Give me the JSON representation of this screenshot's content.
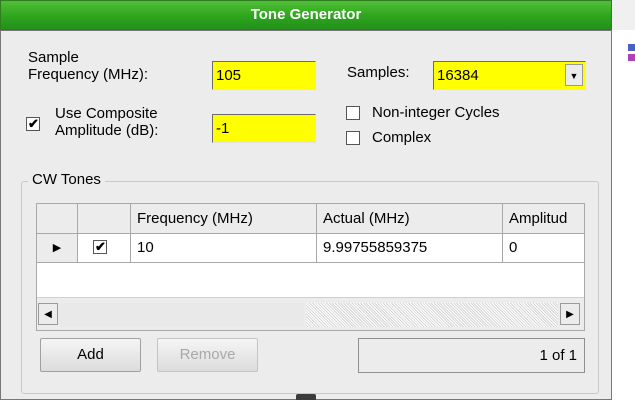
{
  "window": {
    "title": "Tone Generator"
  },
  "form": {
    "sample_frequency_label_1": "Sample",
    "sample_frequency_label_2": "Frequency (MHz):",
    "sample_frequency_value": "105",
    "samples_label": "Samples:",
    "samples_value": "16384",
    "use_composite_label_1": "Use Composite",
    "use_composite_label_2": "Amplitude (dB):",
    "use_composite_checked": true,
    "composite_amplitude_value": "-1",
    "non_integer_label": "Non-integer Cycles",
    "non_integer_checked": false,
    "complex_label": "Complex",
    "complex_checked": false
  },
  "cw_tones": {
    "title": "CW Tones",
    "columns": [
      "Frequency (MHz)",
      "Actual (MHz)",
      "Amplitud"
    ],
    "rows": [
      {
        "enabled": true,
        "frequency": "10",
        "actual": "9.99755859375",
        "amplitude": "0"
      }
    ],
    "add_label": "Add",
    "remove_label": "Remove",
    "status": "1 of 1"
  },
  "icons": {
    "row_pointer": "▶",
    "check": "✔",
    "dropdown": "▼",
    "scroll_left": "◀",
    "scroll_right": "▶"
  },
  "colors": {
    "title_bar": "#2ea51e",
    "field_highlight": "#ffff00"
  }
}
